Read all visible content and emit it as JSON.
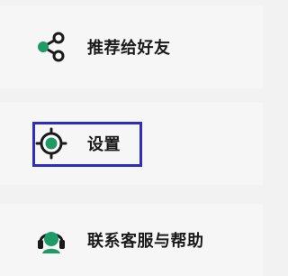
{
  "menu": {
    "items": [
      {
        "label": "推荐给好友",
        "icon": "share-icon"
      },
      {
        "label": "设置",
        "icon": "settings-icon"
      },
      {
        "label": "联系客服与帮助",
        "icon": "headset-icon"
      }
    ]
  },
  "colors": {
    "accent": "#1e9a66",
    "focus": "#2e2dbd",
    "text": "#1a1a1a"
  }
}
